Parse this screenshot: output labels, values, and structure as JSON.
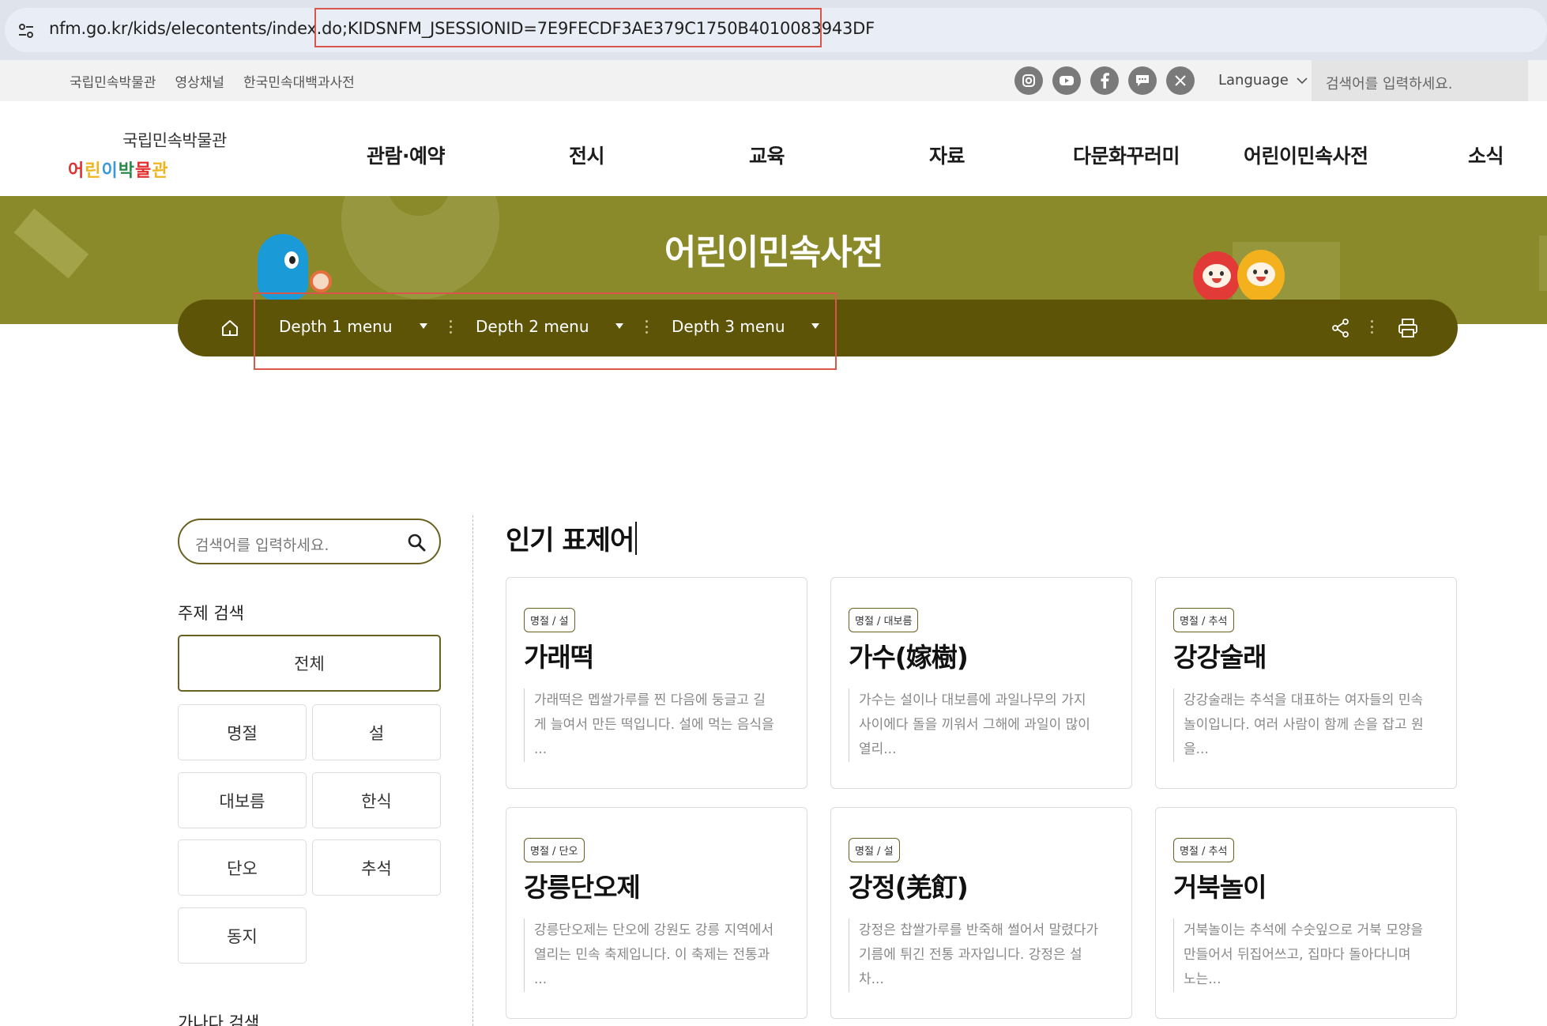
{
  "browser": {
    "url_base": "nfm.go.kr/kids/elecontents/index.do",
    "url_session": ";KIDSNFM_JSESSIONID=7E9FECDF3AE379C1750B4010083943DF"
  },
  "utility": {
    "links": [
      "국립민속박물관",
      "영상채널",
      "한국민속대백과사전"
    ],
    "social_icons": [
      "instagram-icon",
      "youtube-icon",
      "facebook-icon",
      "chat-icon",
      "x-icon"
    ],
    "language_label": "Language",
    "search_placeholder": "검색어를 입력하세요."
  },
  "logo": {
    "top_text": "국립민속박물관",
    "bottom_text": "어린이박물관",
    "colors": [
      "#e0312f",
      "#f0b41e",
      "#3a9ad9",
      "#2a8a4a"
    ]
  },
  "nav": {
    "items": [
      "관람·예약",
      "전시",
      "교육",
      "자료",
      "다문화꾸러미",
      "어린이민속사전",
      "소식"
    ]
  },
  "banner": {
    "title": "어린이민속사전",
    "color": "#8a8a2a"
  },
  "breadcrumb": {
    "depth1": "Depth 1 menu",
    "depth2": "Depth 2 menu",
    "depth3": "Depth 3 menu",
    "bar_color": "#5e5408"
  },
  "sidebar": {
    "search_placeholder": "검색어를 입력하세요.",
    "topic_heading": "주제 검색",
    "categories": [
      "전체",
      "명절",
      "설",
      "대보름",
      "한식",
      "단오",
      "추석",
      "동지"
    ],
    "active_category": "전체",
    "alpha_heading": "가나다 검색"
  },
  "main": {
    "title": "인기 표제어",
    "cards": [
      {
        "tag": "명절 / 설",
        "title": "가래떡",
        "desc": "가래떡은 멥쌀가루를 찐 다음에 둥글고 길게 늘여서 만든 떡입니다. 설에 먹는 음식을 ..."
      },
      {
        "tag": "명절 / 대보름",
        "title": "가수(嫁樹)",
        "desc": "가수는 설이나 대보름에 과일나무의 가지 사이에다 돌을 끼워서 그해에 과일이 많이 열리..."
      },
      {
        "tag": "명절 / 추석",
        "title": "강강술래",
        "desc": "강강술래는 추석을 대표하는 여자들의 민속놀이입니다. 여러 사람이 함께 손을 잡고 원을..."
      },
      {
        "tag": "명절 / 단오",
        "title": "강릉단오제",
        "desc": "강릉단오제는 단오에 강원도 강릉 지역에서 열리는 민속 축제입니다. 이 축제는 전통과 ..."
      },
      {
        "tag": "명절 / 설",
        "title": "강정(羌飣)",
        "desc": "강정은 찹쌀가루를 반죽해 썰어서 말렸다가 기름에 튀긴 전통 과자입니다. 강정은 설 차..."
      },
      {
        "tag": "명절 / 추석",
        "title": "거북놀이",
        "desc": "거북놀이는 추석에 수숫잎으로 거북 모양을 만들어서 뒤집어쓰고, 집마다 돌아다니며 노는..."
      }
    ]
  },
  "accent_color": "#6a6020",
  "highlight_color": "#d9574a"
}
